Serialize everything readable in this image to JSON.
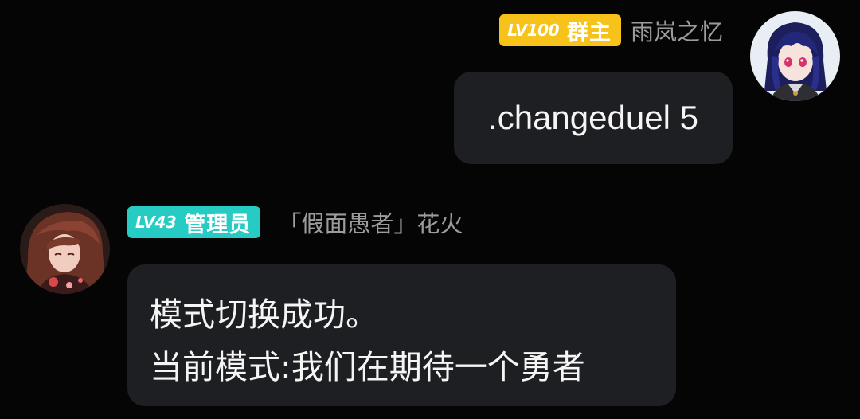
{
  "messages": [
    {
      "side": "right",
      "badge": {
        "level": "LV100",
        "role": "群主",
        "color": "#f7c21a"
      },
      "sender": "雨岚之忆",
      "lines": [
        ".changeduel 5"
      ],
      "avatar_icon": "user-avatar-blue-hair-icon"
    },
    {
      "side": "left",
      "badge": {
        "level": "LV43",
        "role": "管理员",
        "color": "#26cbc4"
      },
      "sender": "「假面愚者」花火",
      "lines": [
        "模式切换成功。",
        "当前模式:我们在期待一个勇者"
      ],
      "avatar_icon": "bot-avatar-red-hair-icon"
    }
  ],
  "colors": {
    "background": "#050505",
    "bubble": "#1e1f22",
    "sender_name": "#9c9c9c",
    "message_text": "#f5f5f5"
  }
}
